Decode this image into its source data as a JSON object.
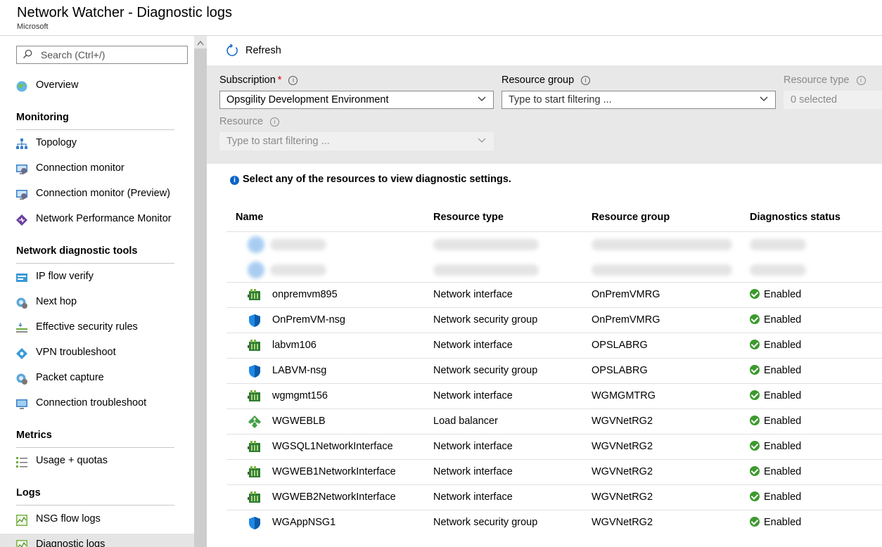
{
  "header": {
    "title": "Network Watcher - Diagnostic logs",
    "subtitle": "Microsoft"
  },
  "sidebar": {
    "search_placeholder": "Search (Ctrl+/)",
    "collapse_glyph": "«",
    "overview": "Overview",
    "sections": {
      "monitoring": "Monitoring",
      "tools": "Network diagnostic tools",
      "metrics": "Metrics",
      "logs": "Logs"
    },
    "items": {
      "topology": "Topology",
      "connection_monitor": "Connection monitor",
      "connection_monitor_preview": "Connection monitor (Preview)",
      "npm": "Network Performance Monitor",
      "ip_flow": "IP flow verify",
      "next_hop": "Next hop",
      "effective_rules": "Effective security rules",
      "vpn": "VPN troubleshoot",
      "packet_capture": "Packet capture",
      "conn_troubleshoot": "Connection troubleshoot",
      "usage": "Usage + quotas",
      "nsg_flow": "NSG flow logs",
      "diag_logs": "Diagnostic logs"
    }
  },
  "toolbar": {
    "refresh_label": "Refresh"
  },
  "filters": {
    "subscription_label": "Subscription",
    "required_mark": "*",
    "subscription_value": "Opsgility Development Environment",
    "resource_group_label": "Resource group",
    "resource_group_placeholder": "Type to start filtering ...",
    "resource_type_label": "Resource type",
    "resource_type_value": "0 selected",
    "resource_label": "Resource",
    "resource_placeholder": "Type to start filtering ..."
  },
  "info_message": "Select any of the resources to view diagnostic settings.",
  "table": {
    "headers": {
      "name": "Name",
      "type": "Resource type",
      "group": "Resource group",
      "status": "Diagnostics status"
    },
    "rows": [
      {
        "name": "onpremvm895",
        "type": "Network interface",
        "group": "OnPremVMRG",
        "status": "Enabled",
        "icon": "nic-icon"
      },
      {
        "name": "OnPremVM-nsg",
        "type": "Network security group",
        "group": "OnPremVMRG",
        "status": "Enabled",
        "icon": "nsg-shield-icon"
      },
      {
        "name": "labvm106",
        "type": "Network interface",
        "group": "OPSLABRG",
        "status": "Enabled",
        "icon": "nic-icon"
      },
      {
        "name": "LABVM-nsg",
        "type": "Network security group",
        "group": "OPSLABRG",
        "status": "Enabled",
        "icon": "nsg-shield-icon"
      },
      {
        "name": "wgmgmt156",
        "type": "Network interface",
        "group": "WGMGMTRG",
        "status": "Enabled",
        "icon": "nic-icon"
      },
      {
        "name": "WGWEBLB",
        "type": "Load balancer",
        "group": "WGVNetRG2",
        "status": "Enabled",
        "icon": "load-balancer-icon"
      },
      {
        "name": "WGSQL1NetworkInterface",
        "type": "Network interface",
        "group": "WGVNetRG2",
        "status": "Enabled",
        "icon": "nic-icon"
      },
      {
        "name": "WGWEB1NetworkInterface",
        "type": "Network interface",
        "group": "WGVNetRG2",
        "status": "Enabled",
        "icon": "nic-icon"
      },
      {
        "name": "WGWEB2NetworkInterface",
        "type": "Network interface",
        "group": "WGVNetRG2",
        "status": "Enabled",
        "icon": "nic-icon"
      },
      {
        "name": "WGAppNSG1",
        "type": "Network security group",
        "group": "WGVNetRG2",
        "status": "Enabled",
        "icon": "nsg-shield-icon"
      }
    ]
  },
  "colors": {
    "accent_blue": "#0a64c8",
    "status_green": "#3c9a2e",
    "filter_bg": "#e8e8e8",
    "required_red": "#c00000"
  }
}
